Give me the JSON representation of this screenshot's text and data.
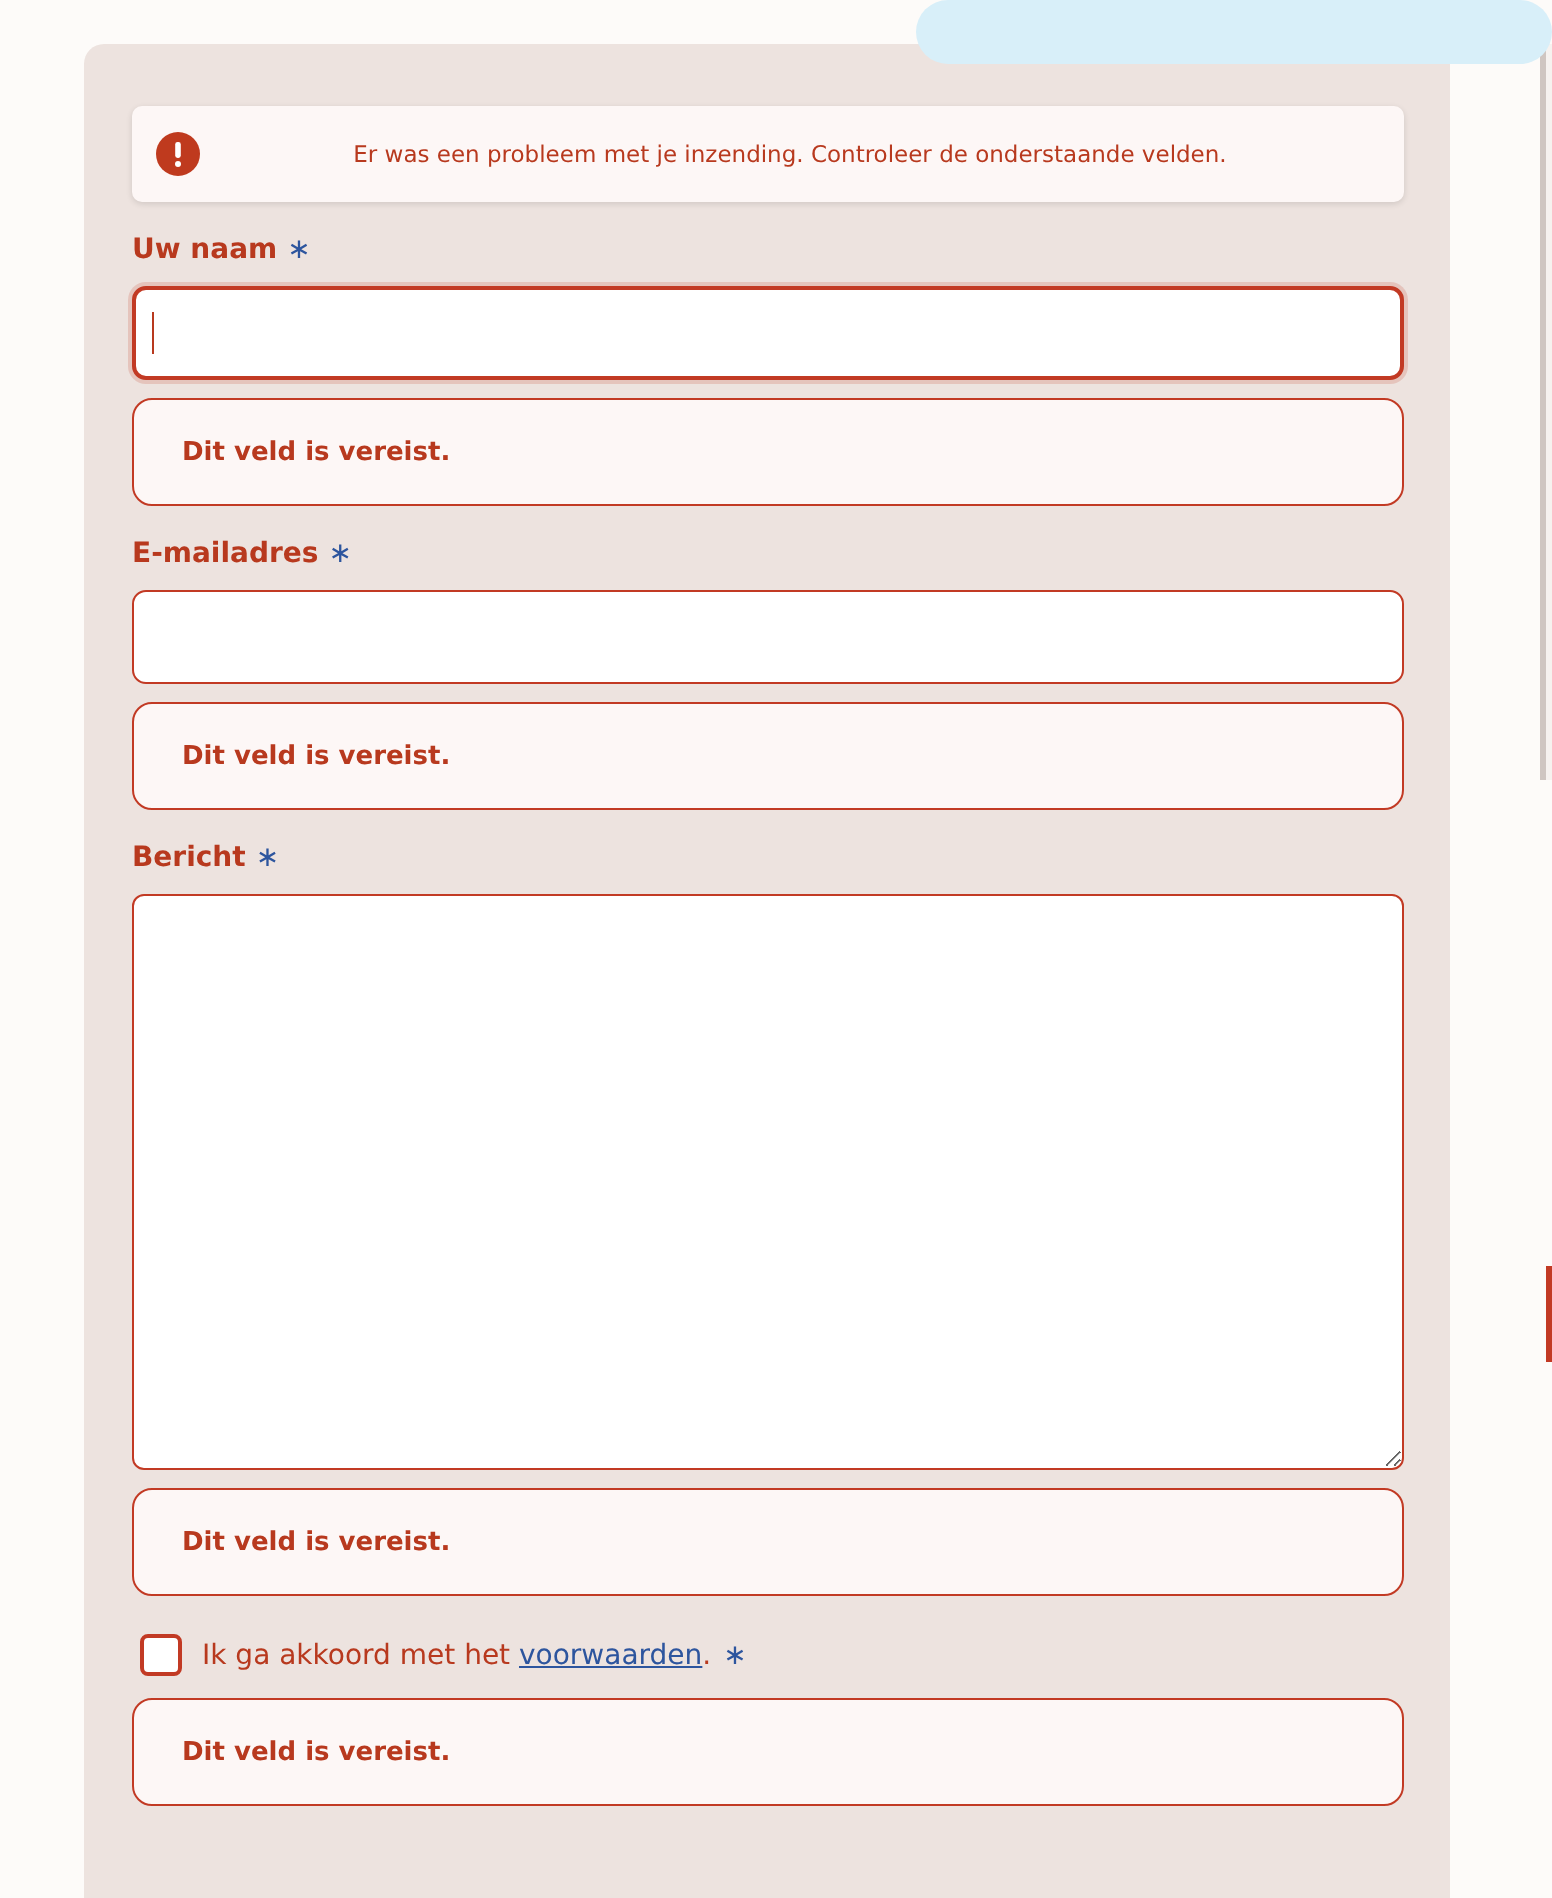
{
  "banner": {
    "message": "Er was een probleem met je inzending. Controleer de onderstaande velden."
  },
  "fields": [
    {
      "kind": "text",
      "label": "Uw naam",
      "required_mark": "∗",
      "focused": true,
      "error": "Dit veld is vereist."
    },
    {
      "kind": "email",
      "label": "E-mailadres",
      "required_mark": "∗",
      "focused": false,
      "error": "Dit veld is vereist."
    },
    {
      "kind": "textarea",
      "label": "Bericht",
      "required_mark": "∗",
      "focused": false,
      "error": "Dit veld is vereist."
    }
  ],
  "consent": {
    "checked": false,
    "text": "Ik ga akkoord met het ",
    "link": "voorwaarden",
    "after": ".",
    "required_mark": "∗",
    "error": "Dit veld is vereist."
  }
}
